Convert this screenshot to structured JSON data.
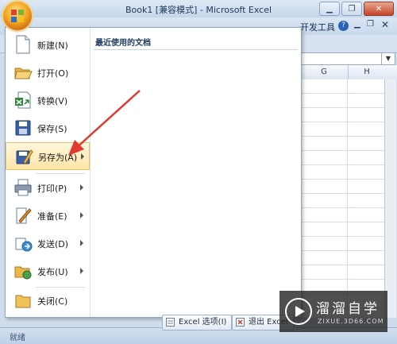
{
  "window": {
    "title": "Book1 [兼容模式] - Microsoft Excel",
    "minimize": "▁",
    "restore": "❐",
    "close": "✕"
  },
  "ribbon": {
    "visible_tab": "开发工具",
    "help": "?",
    "minimize": "▁",
    "restore": "❐",
    "close": "✕"
  },
  "sheet": {
    "columns": [
      "G",
      "H"
    ],
    "formula_dropdown": "▼"
  },
  "office_menu": {
    "items": [
      {
        "label": "新建(N)",
        "icon": "new-document-icon",
        "submenu": false
      },
      {
        "label": "打开(O)",
        "icon": "open-folder-icon",
        "submenu": false
      },
      {
        "label": "转换(V)",
        "icon": "convert-icon",
        "submenu": false
      },
      {
        "label": "保存(S)",
        "icon": "save-disk-icon",
        "submenu": false
      },
      {
        "label": "另存为(A)",
        "icon": "save-as-icon",
        "submenu": true,
        "highlighted": true
      },
      {
        "label": "打印(P)",
        "icon": "printer-icon",
        "submenu": true
      },
      {
        "label": "准备(E)",
        "icon": "prepare-pen-icon",
        "submenu": true
      },
      {
        "label": "发送(D)",
        "icon": "send-icon",
        "submenu": true
      },
      {
        "label": "发布(U)",
        "icon": "publish-icon",
        "submenu": true
      },
      {
        "label": "关闭(C)",
        "icon": "close-folder-icon",
        "submenu": false
      }
    ],
    "recent_title": "最近使用的文档",
    "options_button": "Excel 选项(I)",
    "exit_button": "退出 Excel"
  },
  "statusbar": {
    "text": "就绪"
  },
  "watermark": {
    "main": "溜溜自学",
    "sub": "ZIXUE.3D66.COM"
  },
  "colors": {
    "accent": "#f5a623",
    "arrow": "#e03a2e",
    "menu_border": "#8ea6c6"
  }
}
